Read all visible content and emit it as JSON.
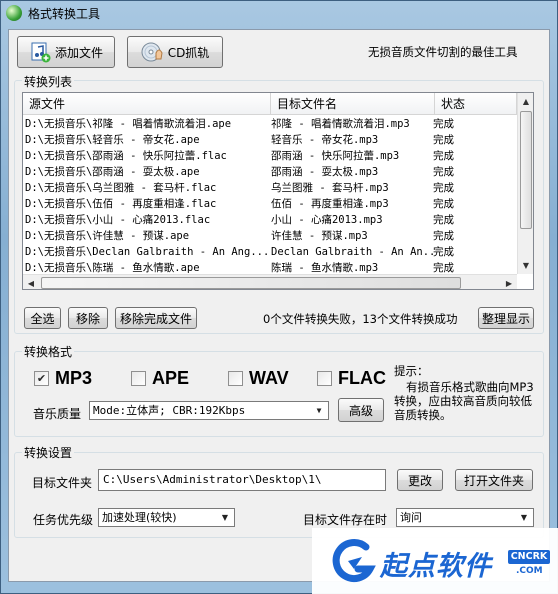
{
  "window": {
    "title": "格式转换工具"
  },
  "toolbar": {
    "add_file": "添加文件",
    "cd_rip": "CD抓轨",
    "slogan": "无损音质文件切割的最佳工具"
  },
  "convert_list": {
    "title": "转换列表",
    "columns": [
      "源文件",
      "目标文件名",
      "状态"
    ],
    "rows": [
      {
        "src": "D:\\无损音乐\\祁隆 - 唱着情歌流着泪.ape",
        "dst": "祁隆 - 唱着情歌流着泪.mp3",
        "status": "完成"
      },
      {
        "src": "D:\\无损音乐\\轻音乐 - 帝女花.ape",
        "dst": "轻音乐 - 帝女花.mp3",
        "status": "完成"
      },
      {
        "src": "D:\\无损音乐\\邵雨涵 - 快乐阿拉蕾.flac",
        "dst": "邵雨涵 - 快乐阿拉蕾.mp3",
        "status": "完成"
      },
      {
        "src": "D:\\无损音乐\\邵雨涵 - 耍太极.ape",
        "dst": "邵雨涵 - 耍太极.mp3",
        "status": "完成"
      },
      {
        "src": "D:\\无损音乐\\乌兰图雅 - 套马杆.flac",
        "dst": "乌兰图雅 - 套马杆.mp3",
        "status": "完成"
      },
      {
        "src": "D:\\无损音乐\\伍佰 - 再度重相逢.flac",
        "dst": "伍佰 - 再度重相逢.mp3",
        "status": "完成"
      },
      {
        "src": "D:\\无损音乐\\小山 - 心痛2013.flac",
        "dst": "小山 - 心痛2013.mp3",
        "status": "完成"
      },
      {
        "src": "D:\\无损音乐\\许佳慧 - 预谋.ape",
        "dst": "许佳慧 - 预谋.mp3",
        "status": "完成"
      },
      {
        "src": "D:\\无损音乐\\Declan Galbraith - An Ang...",
        "dst": "Declan Galbraith - An An...",
        "status": "完成"
      },
      {
        "src": "D:\\无损音乐\\陈瑞 - 鱼水情歌.ape",
        "dst": "陈瑞 - 鱼水情歌.mp3",
        "status": "完成"
      }
    ],
    "select_all": "全选",
    "remove": "移除",
    "remove_done": "移除完成文件",
    "summary": "0个文件转换失败，13个文件转换成功",
    "tidy": "整理显示"
  },
  "format": {
    "title": "转换格式",
    "options": [
      {
        "label": "MP3",
        "checked": true
      },
      {
        "label": "APE",
        "checked": false
      },
      {
        "label": "WAV",
        "checked": false
      },
      {
        "label": "FLAC",
        "checked": false
      }
    ],
    "quality_label": "音乐质量",
    "quality_value": "Mode:立体声; CBR:192Kbps",
    "advanced": "高级",
    "hint_title": "提示：",
    "hint_text": "有损音乐格式歌曲向MP3转换，应由较高音质向较低音质转换。"
  },
  "settings": {
    "title": "转换设置",
    "target_label": "目标文件夹",
    "target_value": "C:\\Users\\Administrator\\Desktop\\1\\",
    "change": "更改",
    "open_folder": "打开文件夹",
    "priority_label": "任务优先级",
    "priority_value": "加速处理(较快)",
    "exists_label": "目标文件存在时",
    "exists_value": "询问"
  },
  "watermark": {
    "brand": "起点软件",
    "domain": "CNCRK",
    "suffix": ".COM"
  },
  "colors": {
    "accent": "#1e64c8",
    "watermark_blue": "#1b66d2"
  }
}
